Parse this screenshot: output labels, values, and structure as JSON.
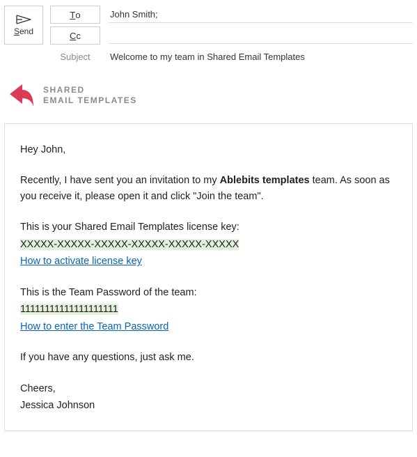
{
  "header": {
    "send_label": "end",
    "send_prefix": "S",
    "to_label": "o",
    "to_prefix": "T",
    "to_value": "John Smith;",
    "cc_label": "c",
    "cc_prefix": "C",
    "cc_value": "",
    "subject_label": "Subject",
    "subject_value": "Welcome to my team in Shared Email Templates"
  },
  "brand": {
    "line1": "SHARED",
    "line2": "EMAIL TEMPLATES"
  },
  "email": {
    "greeting": "Hey John,",
    "intro1": "Recently, I have sent you an invitation to my ",
    "intro_bold": "Ablebits templates",
    "intro2": " team. As soon as you receive it, please open it and click \"Join the team\".",
    "license_label": "This is your Shared Email Templates license key:",
    "license_key": "XXXXX-XXXXX-XXXXX-XXXXX-XXXXX-XXXXX",
    "license_link": "How to activate license key",
    "teampw_label": "This is the Team Password of the team:",
    "teampw_value": "11111111111111111111",
    "teampw_link": "How to enter the Team Password",
    "ask": "If you have any questions, just ask me.",
    "signoff": "Cheers,",
    "signer": "Jessica Johnson"
  }
}
